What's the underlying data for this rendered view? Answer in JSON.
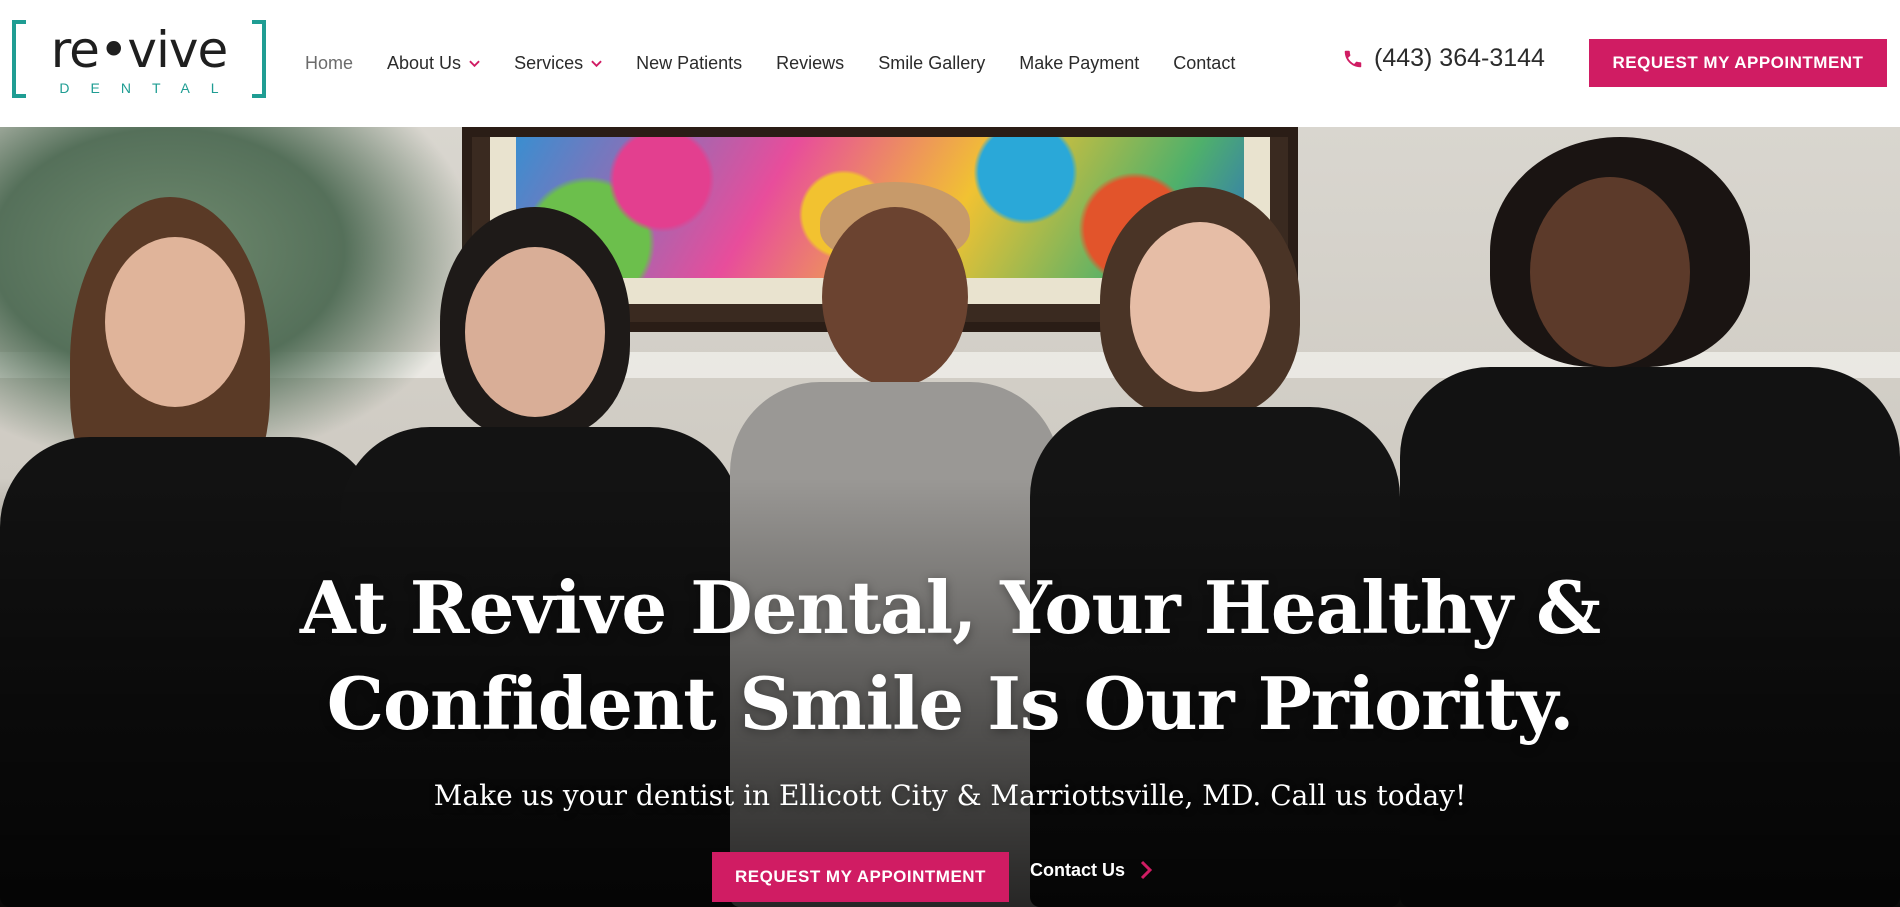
{
  "logo": {
    "wordmark": "re•vive",
    "tagline": "DENTAL"
  },
  "nav": {
    "items": [
      {
        "label": "Home",
        "active": true,
        "dropdown": false
      },
      {
        "label": "About Us",
        "active": false,
        "dropdown": true
      },
      {
        "label": "Services",
        "active": false,
        "dropdown": true
      },
      {
        "label": "New Patients",
        "active": false,
        "dropdown": false
      },
      {
        "label": "Reviews",
        "active": false,
        "dropdown": false
      },
      {
        "label": "Smile Gallery",
        "active": false,
        "dropdown": false
      },
      {
        "label": "Make Payment",
        "active": false,
        "dropdown": false
      },
      {
        "label": "Contact",
        "active": false,
        "dropdown": false
      }
    ]
  },
  "header": {
    "phone": "(443) 364-3144",
    "phone_icon": "phone-icon",
    "cta_label": "REQUEST MY APPOINTMENT"
  },
  "hero": {
    "title_line1": "At Revive Dental, Your Healthy &",
    "title_line2": "Confident Smile Is Our Priority.",
    "subtitle": "Make us your dentist in Ellicott City & Marriottsville, MD. Call us today!",
    "cta_label": "REQUEST MY APPOINTMENT",
    "contact_label": "Contact Us",
    "contact_icon": "chevron-right-icon"
  },
  "colors": {
    "brand_pink": "#d01c63",
    "brand_teal": "#1f9d93",
    "text_dark": "#2b2b2b"
  }
}
